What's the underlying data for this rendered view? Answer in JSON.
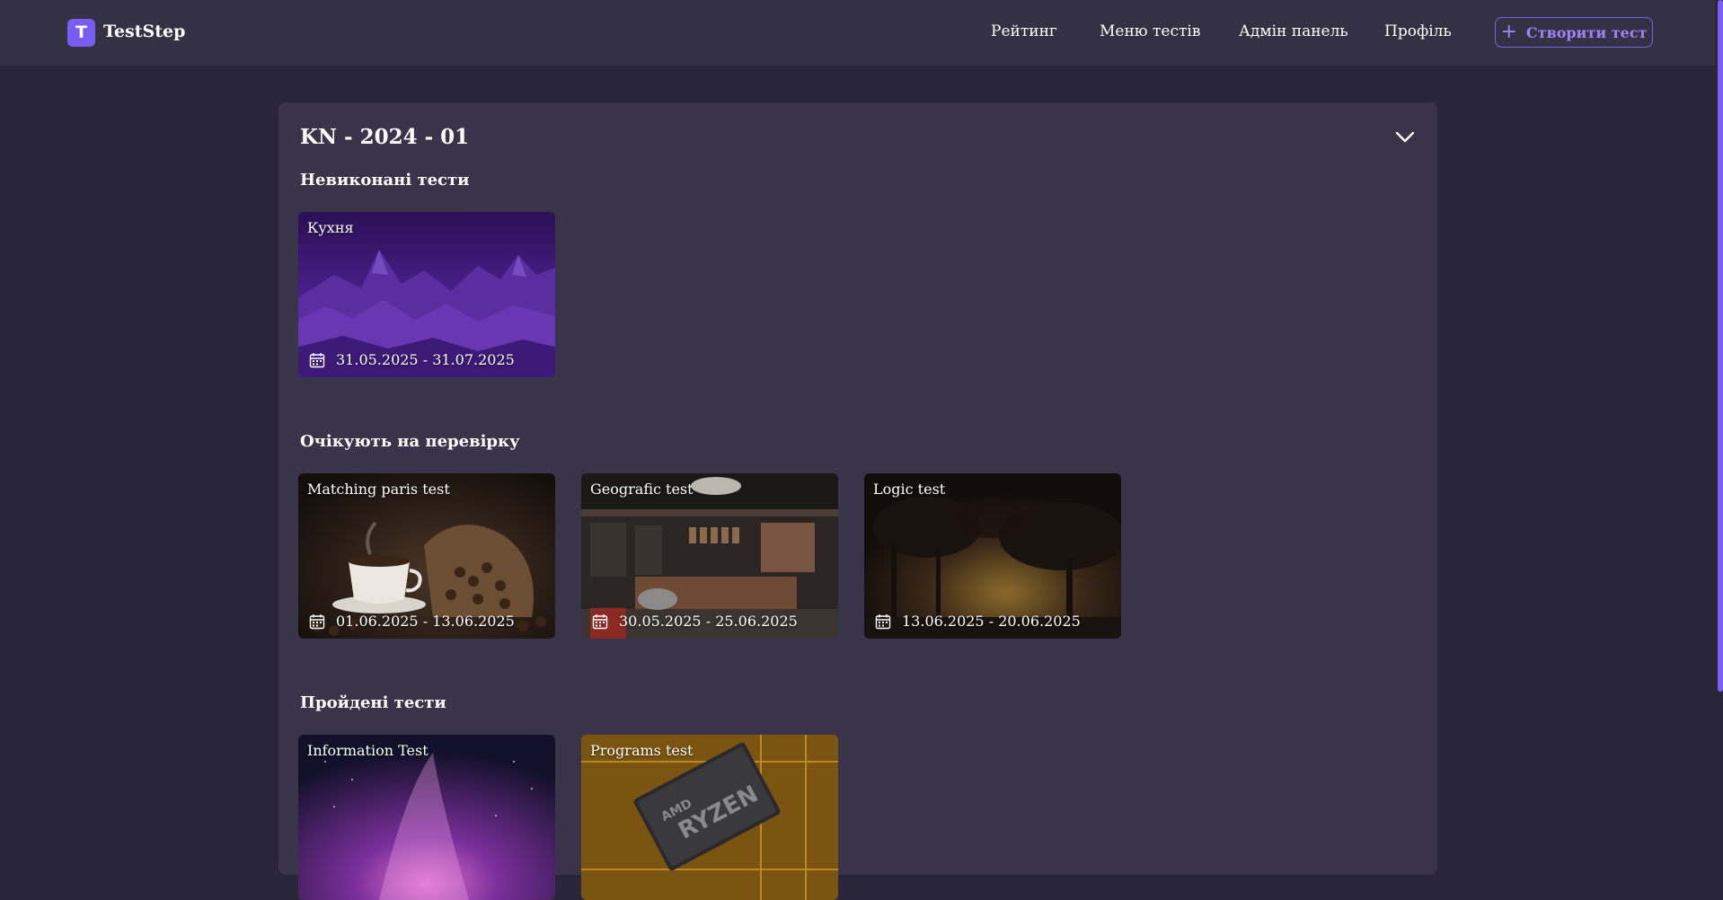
{
  "header": {
    "brand_letter": "T",
    "brand_name": "TestStep",
    "nav": [
      "Рейтинг",
      "Меню тестів",
      "Адмін панель",
      "Профіль"
    ],
    "create_label": "Створити тест"
  },
  "group": {
    "title": "KN - 2024 - 01"
  },
  "sections": {
    "incomplete": {
      "title": "Невиконані тести",
      "cards": [
        {
          "title": "Кухня",
          "dates": "31.05.2025 - 31.07.2025"
        }
      ]
    },
    "pending": {
      "title": "Очікують на перевірку",
      "cards": [
        {
          "title": "Matching paris test",
          "dates": "01.06.2025 - 13.06.2025"
        },
        {
          "title": "Geografic test",
          "dates": "30.05.2025 - 25.06.2025"
        },
        {
          "title": "Logic test",
          "dates": "13.06.2025 - 20.06.2025"
        }
      ]
    },
    "passed": {
      "title": "Пройдені тести",
      "cards": [
        {
          "title": "Information Test"
        },
        {
          "title": "Programs test"
        }
      ]
    }
  },
  "icons": {
    "calendar": "calendar-icon",
    "chevron": "chevron-down-icon",
    "plus": "plus-icon"
  },
  "colors": {
    "accent": "#7b5cf2",
    "background": "#2a2639",
    "topbar": "#353144",
    "panel": "#393449"
  }
}
